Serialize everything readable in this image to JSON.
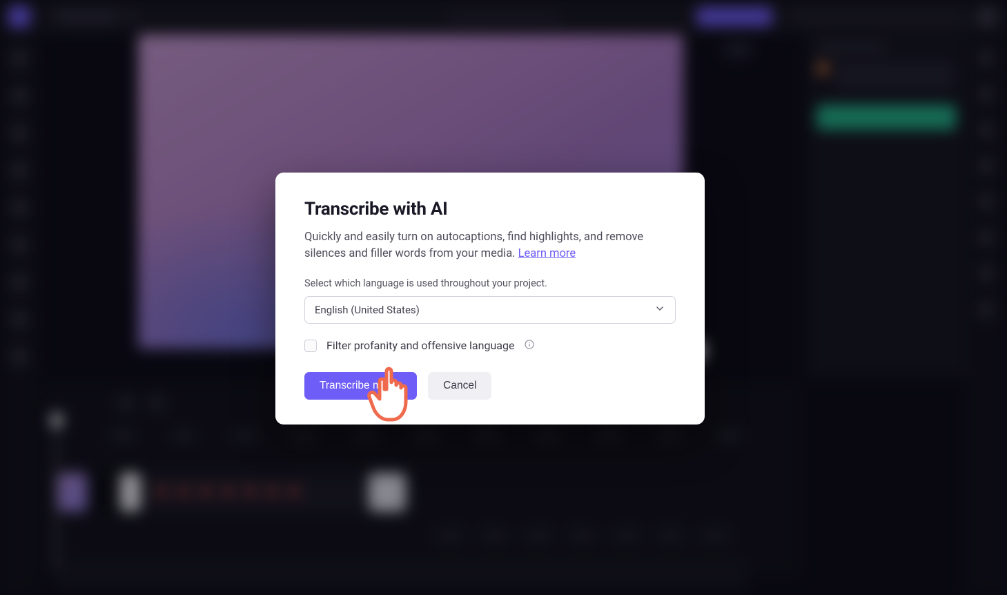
{
  "modal": {
    "title": "Transcribe with AI",
    "description_pre": "Quickly and easily turn on autocaptions, find highlights, and remove silences and filler words from your media. ",
    "learn_more": "Learn more",
    "select_label": "Select which language is used throughout your project.",
    "language_selected": "English (United States)",
    "filter_label": "Filter profanity and offensive language",
    "transcribe_btn": "Transcribe media",
    "cancel_btn": "Cancel"
  }
}
